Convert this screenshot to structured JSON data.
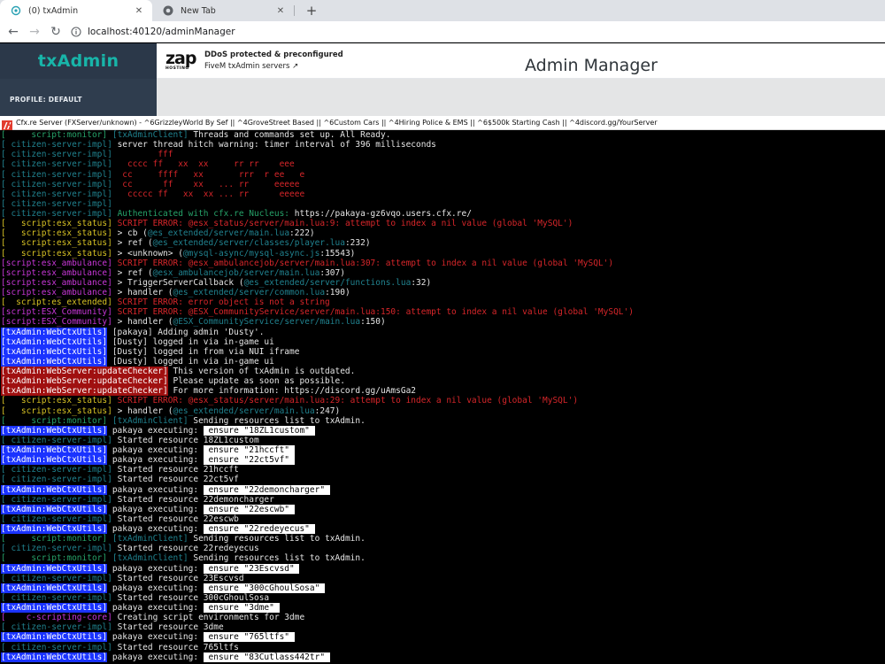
{
  "browser": {
    "tabs": [
      {
        "title": "(0) txAdmin",
        "icon": "txadmin-icon",
        "active": true
      },
      {
        "title": "New Tab",
        "icon": "chrome-icon",
        "active": false
      }
    ],
    "close_glyph": "✕",
    "new_tab_glyph": "+",
    "back_glyph": "←",
    "forward_glyph": "→",
    "reload_glyph": "↻",
    "address": "localhost:40120/adminManager"
  },
  "page": {
    "brand": "txAdmin",
    "profile": "PROFILE: DEFAULT",
    "sponsor_logo_text": "zap",
    "sponsor_logo_sub": "HOSTING",
    "sponsor_line1": "DDoS protected & preconfigured",
    "sponsor_line2": "FiveM txAdmin servers ↗",
    "title": "Admin Manager"
  },
  "console": {
    "title": "Cfx.re Server (FXServer/unknown) - ^6GrizzleyWorld By Sef || ^4GroveStreet Based || ^6Custom Cars || ^4Hiring Police & EMS || ^6$500k Starting Cash || ^4discord.gg/YourServer",
    "colors": {
      "cyan": "#2aa1b3",
      "green": "#26a269",
      "yellow": "#d7c224",
      "magenta": "#c837d8",
      "red": "#d7262a",
      "blue_bg": "#1a33ff",
      "red_bg": "#a01010"
    },
    "lines": [
      [
        [
          "[     script:monitor] ",
          "c-green"
        ],
        [
          "[txAdminClient] ",
          "c-darkcyan"
        ],
        [
          "Threads and commands set up. All Ready.",
          "c-white"
        ]
      ],
      [
        [
          "[ citizen-server-impl] ",
          "c-darkcyan"
        ],
        [
          "server thread hitch warning: timer interval of 396 milliseconds",
          "c-white"
        ]
      ],
      [
        [
          "[ citizen-server-impl] ",
          "c-darkcyan"
        ],
        [
          "        fff",
          "c-red"
        ]
      ],
      [
        [
          "[ citizen-server-impl] ",
          "c-darkcyan"
        ],
        [
          "  cccc ff   xx  xx     rr rr    eee",
          "c-red"
        ]
      ],
      [
        [
          "[ citizen-server-impl] ",
          "c-darkcyan"
        ],
        [
          " cc     ffff   xx       rrr  r ee   e",
          "c-red"
        ]
      ],
      [
        [
          "[ citizen-server-impl] ",
          "c-darkcyan"
        ],
        [
          " cc      ff    xx   ... rr     eeeee",
          "c-red"
        ]
      ],
      [
        [
          "[ citizen-server-impl] ",
          "c-darkcyan"
        ],
        [
          "  ccccc ff   xx  xx ... rr      eeeee",
          "c-red"
        ]
      ],
      [
        [
          "[ citizen-server-impl] ",
          "c-darkcyan"
        ],
        [
          "",
          "c-white"
        ]
      ],
      [
        [
          "[ citizen-server-impl] ",
          "c-darkcyan"
        ],
        [
          "Authenticated with cfx.re Nucleus: ",
          "c-green"
        ],
        [
          "https://pakaya-gz6vqo.users.cfx.re/",
          "c-white"
        ]
      ],
      [
        [
          "[   script:esx_status] ",
          "c-yellow"
        ],
        [
          "SCRIPT ERROR: @esx_status/server/main.lua:9: attempt to index a nil value (global 'MySQL')",
          "c-red"
        ]
      ],
      [
        [
          "[   script:esx_status] ",
          "c-yellow"
        ],
        [
          "> cb (",
          "c-white"
        ],
        [
          "@es_extended/server/main.lua",
          "c-darkcyan"
        ],
        [
          ":222)",
          "c-white"
        ]
      ],
      [
        [
          "[   script:esx_status] ",
          "c-yellow"
        ],
        [
          "> ref (",
          "c-white"
        ],
        [
          "@es_extended/server/classes/player.lua",
          "c-darkcyan"
        ],
        [
          ":232)",
          "c-white"
        ]
      ],
      [
        [
          "[   script:esx_status] ",
          "c-yellow"
        ],
        [
          "> <unknown> (",
          "c-white"
        ],
        [
          "@mysql-async/mysql-async.js",
          "c-darkcyan"
        ],
        [
          ":15543)",
          "c-white"
        ]
      ],
      [
        [
          "[script:esx_ambulance] ",
          "c-magenta"
        ],
        [
          "SCRIPT ERROR: @esx_ambulancejob/server/main.lua:307: attempt to index a nil value (global 'MySQL')",
          "c-red"
        ]
      ],
      [
        [
          "[script:esx_ambulance] ",
          "c-magenta"
        ],
        [
          "> ref (",
          "c-white"
        ],
        [
          "@esx_ambulancejob/server/main.lua",
          "c-darkcyan"
        ],
        [
          ":307)",
          "c-white"
        ]
      ],
      [
        [
          "[script:esx_ambulance] ",
          "c-magenta"
        ],
        [
          "> TriggerServerCallback (",
          "c-white"
        ],
        [
          "@es_extended/server/functions.lua",
          "c-darkcyan"
        ],
        [
          ":32)",
          "c-white"
        ]
      ],
      [
        [
          "[script:esx_ambulance] ",
          "c-magenta"
        ],
        [
          "> handler (",
          "c-white"
        ],
        [
          "@es_extended/server/common.lua",
          "c-darkcyan"
        ],
        [
          ":190)",
          "c-white"
        ]
      ],
      [
        [
          "[  script:es_extended] ",
          "c-yellow"
        ],
        [
          "SCRIPT ERROR: error object is not a string",
          "c-red"
        ]
      ],
      [
        [
          "[script:ESX_Community] ",
          "c-magenta"
        ],
        [
          "SCRIPT ERROR: @ESX_CommunityService/server/main.lua:150: attempt to index a nil value (global 'MySQL')",
          "c-red"
        ]
      ],
      [
        [
          "[script:ESX_Community] ",
          "c-magenta"
        ],
        [
          "> handler (",
          "c-white"
        ],
        [
          "@ESX_CommunityService/server/main.lua",
          "c-darkcyan"
        ],
        [
          ":150)",
          "c-white"
        ]
      ],
      [
        [
          "[txAdmin:WebCtxUtils]",
          "bg-blue"
        ],
        [
          " [pakaya] Adding admin 'Dusty'.",
          "c-white"
        ]
      ],
      [
        [
          "[txAdmin:WebCtxUtils]",
          "bg-blue"
        ],
        [
          " [Dusty] logged in via in-game ui",
          "c-white"
        ]
      ],
      [
        [
          "[txAdmin:WebCtxUtils]",
          "bg-blue"
        ],
        [
          " [Dusty] logged in from via NUI iframe",
          "c-white"
        ]
      ],
      [
        [
          "[txAdmin:WebCtxUtils]",
          "bg-blue"
        ],
        [
          " [Dusty] logged in via in-game ui",
          "c-white"
        ]
      ],
      [
        [
          "[txAdmin:WebServer:updateChecker]",
          "bg-red"
        ],
        [
          " This version of txAdmin is outdated.",
          "c-white"
        ]
      ],
      [
        [
          "[txAdmin:WebServer:updateChecker]",
          "bg-red"
        ],
        [
          " Please update as soon as possible.",
          "c-white"
        ]
      ],
      [
        [
          "[txAdmin:WebServer:updateChecker]",
          "bg-red"
        ],
        [
          " For more information: https://discord.gg/uAmsGa2",
          "c-white"
        ]
      ],
      [
        [
          "[   script:esx_status] ",
          "c-yellow"
        ],
        [
          "SCRIPT ERROR: @esx_status/server/main.lua:29: attempt to index a nil value (global 'MySQL')",
          "c-red"
        ]
      ],
      [
        [
          "[   script:esx_status] ",
          "c-yellow"
        ],
        [
          "> handler (",
          "c-white"
        ],
        [
          "@es_extended/server/main.lua",
          "c-darkcyan"
        ],
        [
          ":247)",
          "c-white"
        ]
      ],
      [
        [
          "[     script:monitor] ",
          "c-green"
        ],
        [
          "[txAdminClient] ",
          "c-darkcyan"
        ],
        [
          "Sending resources list to txAdmin.",
          "c-white"
        ]
      ],
      [
        [
          "[txAdmin:WebCtxUtils]",
          "bg-blue"
        ],
        [
          " pakaya executing: ",
          "c-white"
        ],
        [
          " ensure \"18ZL1custom\" ",
          "bg-white"
        ]
      ],
      [
        [
          "[ citizen-server-impl] ",
          "c-darkcyan"
        ],
        [
          "Started resource 18ZL1custom",
          "c-white"
        ]
      ],
      [
        [
          "[txAdmin:WebCtxUtils]",
          "bg-blue"
        ],
        [
          " pakaya executing: ",
          "c-white"
        ],
        [
          " ensure \"21hccft\" ",
          "bg-white"
        ]
      ],
      [
        [
          "[txAdmin:WebCtxUtils]",
          "bg-blue"
        ],
        [
          " pakaya executing: ",
          "c-white"
        ],
        [
          " ensure \"22ct5vf\" ",
          "bg-white"
        ]
      ],
      [
        [
          "[ citizen-server-impl] ",
          "c-darkcyan"
        ],
        [
          "Started resource 21hccft",
          "c-white"
        ]
      ],
      [
        [
          "[ citizen-server-impl] ",
          "c-darkcyan"
        ],
        [
          "Started resource 22ct5vf",
          "c-white"
        ]
      ],
      [
        [
          "[txAdmin:WebCtxUtils]",
          "bg-blue"
        ],
        [
          " pakaya executing: ",
          "c-white"
        ],
        [
          " ensure \"22demoncharger\" ",
          "bg-white"
        ]
      ],
      [
        [
          "[ citizen-server-impl] ",
          "c-darkcyan"
        ],
        [
          "Started resource 22demoncharger",
          "c-white"
        ]
      ],
      [
        [
          "[txAdmin:WebCtxUtils]",
          "bg-blue"
        ],
        [
          " pakaya executing: ",
          "c-white"
        ],
        [
          " ensure \"22escwb\" ",
          "bg-white"
        ]
      ],
      [
        [
          "[ citizen-server-impl] ",
          "c-darkcyan"
        ],
        [
          "Started resource 22escwb",
          "c-white"
        ]
      ],
      [
        [
          "[txAdmin:WebCtxUtils]",
          "bg-blue"
        ],
        [
          " pakaya executing: ",
          "c-white"
        ],
        [
          " ensure \"22redeyecus\" ",
          "bg-white"
        ]
      ],
      [
        [
          "[     script:monitor] ",
          "c-green"
        ],
        [
          "[txAdminClient] ",
          "c-darkcyan"
        ],
        [
          "Sending resources list to txAdmin.",
          "c-white"
        ]
      ],
      [
        [
          "[ citizen-server-impl] ",
          "c-darkcyan"
        ],
        [
          "Started resource 22redeyecus",
          "c-white"
        ]
      ],
      [
        [
          "[     script:monitor] ",
          "c-green"
        ],
        [
          "[txAdminClient] ",
          "c-darkcyan"
        ],
        [
          "Sending resources list to txAdmin.",
          "c-white"
        ]
      ],
      [
        [
          "[txAdmin:WebCtxUtils]",
          "bg-blue"
        ],
        [
          " pakaya executing: ",
          "c-white"
        ],
        [
          " ensure \"23Escvsd\" ",
          "bg-white"
        ]
      ],
      [
        [
          "[ citizen-server-impl] ",
          "c-darkcyan"
        ],
        [
          "Started resource 23Escvsd",
          "c-white"
        ]
      ],
      [
        [
          "[txAdmin:WebCtxUtils]",
          "bg-blue"
        ],
        [
          " pakaya executing: ",
          "c-white"
        ],
        [
          " ensure \"300cGhoulSosa\" ",
          "bg-white"
        ]
      ],
      [
        [
          "[ citizen-server-impl] ",
          "c-darkcyan"
        ],
        [
          "Started resource 300cGhoulSosa",
          "c-white"
        ]
      ],
      [
        [
          "[txAdmin:WebCtxUtils]",
          "bg-blue"
        ],
        [
          " pakaya executing: ",
          "c-white"
        ],
        [
          " ensure \"3dme\" ",
          "bg-white"
        ]
      ],
      [
        [
          "[    c-scripting-core] ",
          "c-magenta"
        ],
        [
          "Creating script environments for 3dme",
          "c-white"
        ]
      ],
      [
        [
          "[ citizen-server-impl] ",
          "c-darkcyan"
        ],
        [
          "Started resource 3dme",
          "c-white"
        ]
      ],
      [
        [
          "[txAdmin:WebCtxUtils]",
          "bg-blue"
        ],
        [
          " pakaya executing: ",
          "c-white"
        ],
        [
          " ensure \"765ltfs\" ",
          "bg-white"
        ]
      ],
      [
        [
          "[ citizen-server-impl] ",
          "c-darkcyan"
        ],
        [
          "Started resource 765ltfs",
          "c-white"
        ]
      ],
      [
        [
          "[txAdmin:WebCtxUtils]",
          "bg-blue"
        ],
        [
          " pakaya executing: ",
          "c-white"
        ],
        [
          " ensure \"83Cutlass442tr\" ",
          "bg-white"
        ]
      ]
    ]
  }
}
